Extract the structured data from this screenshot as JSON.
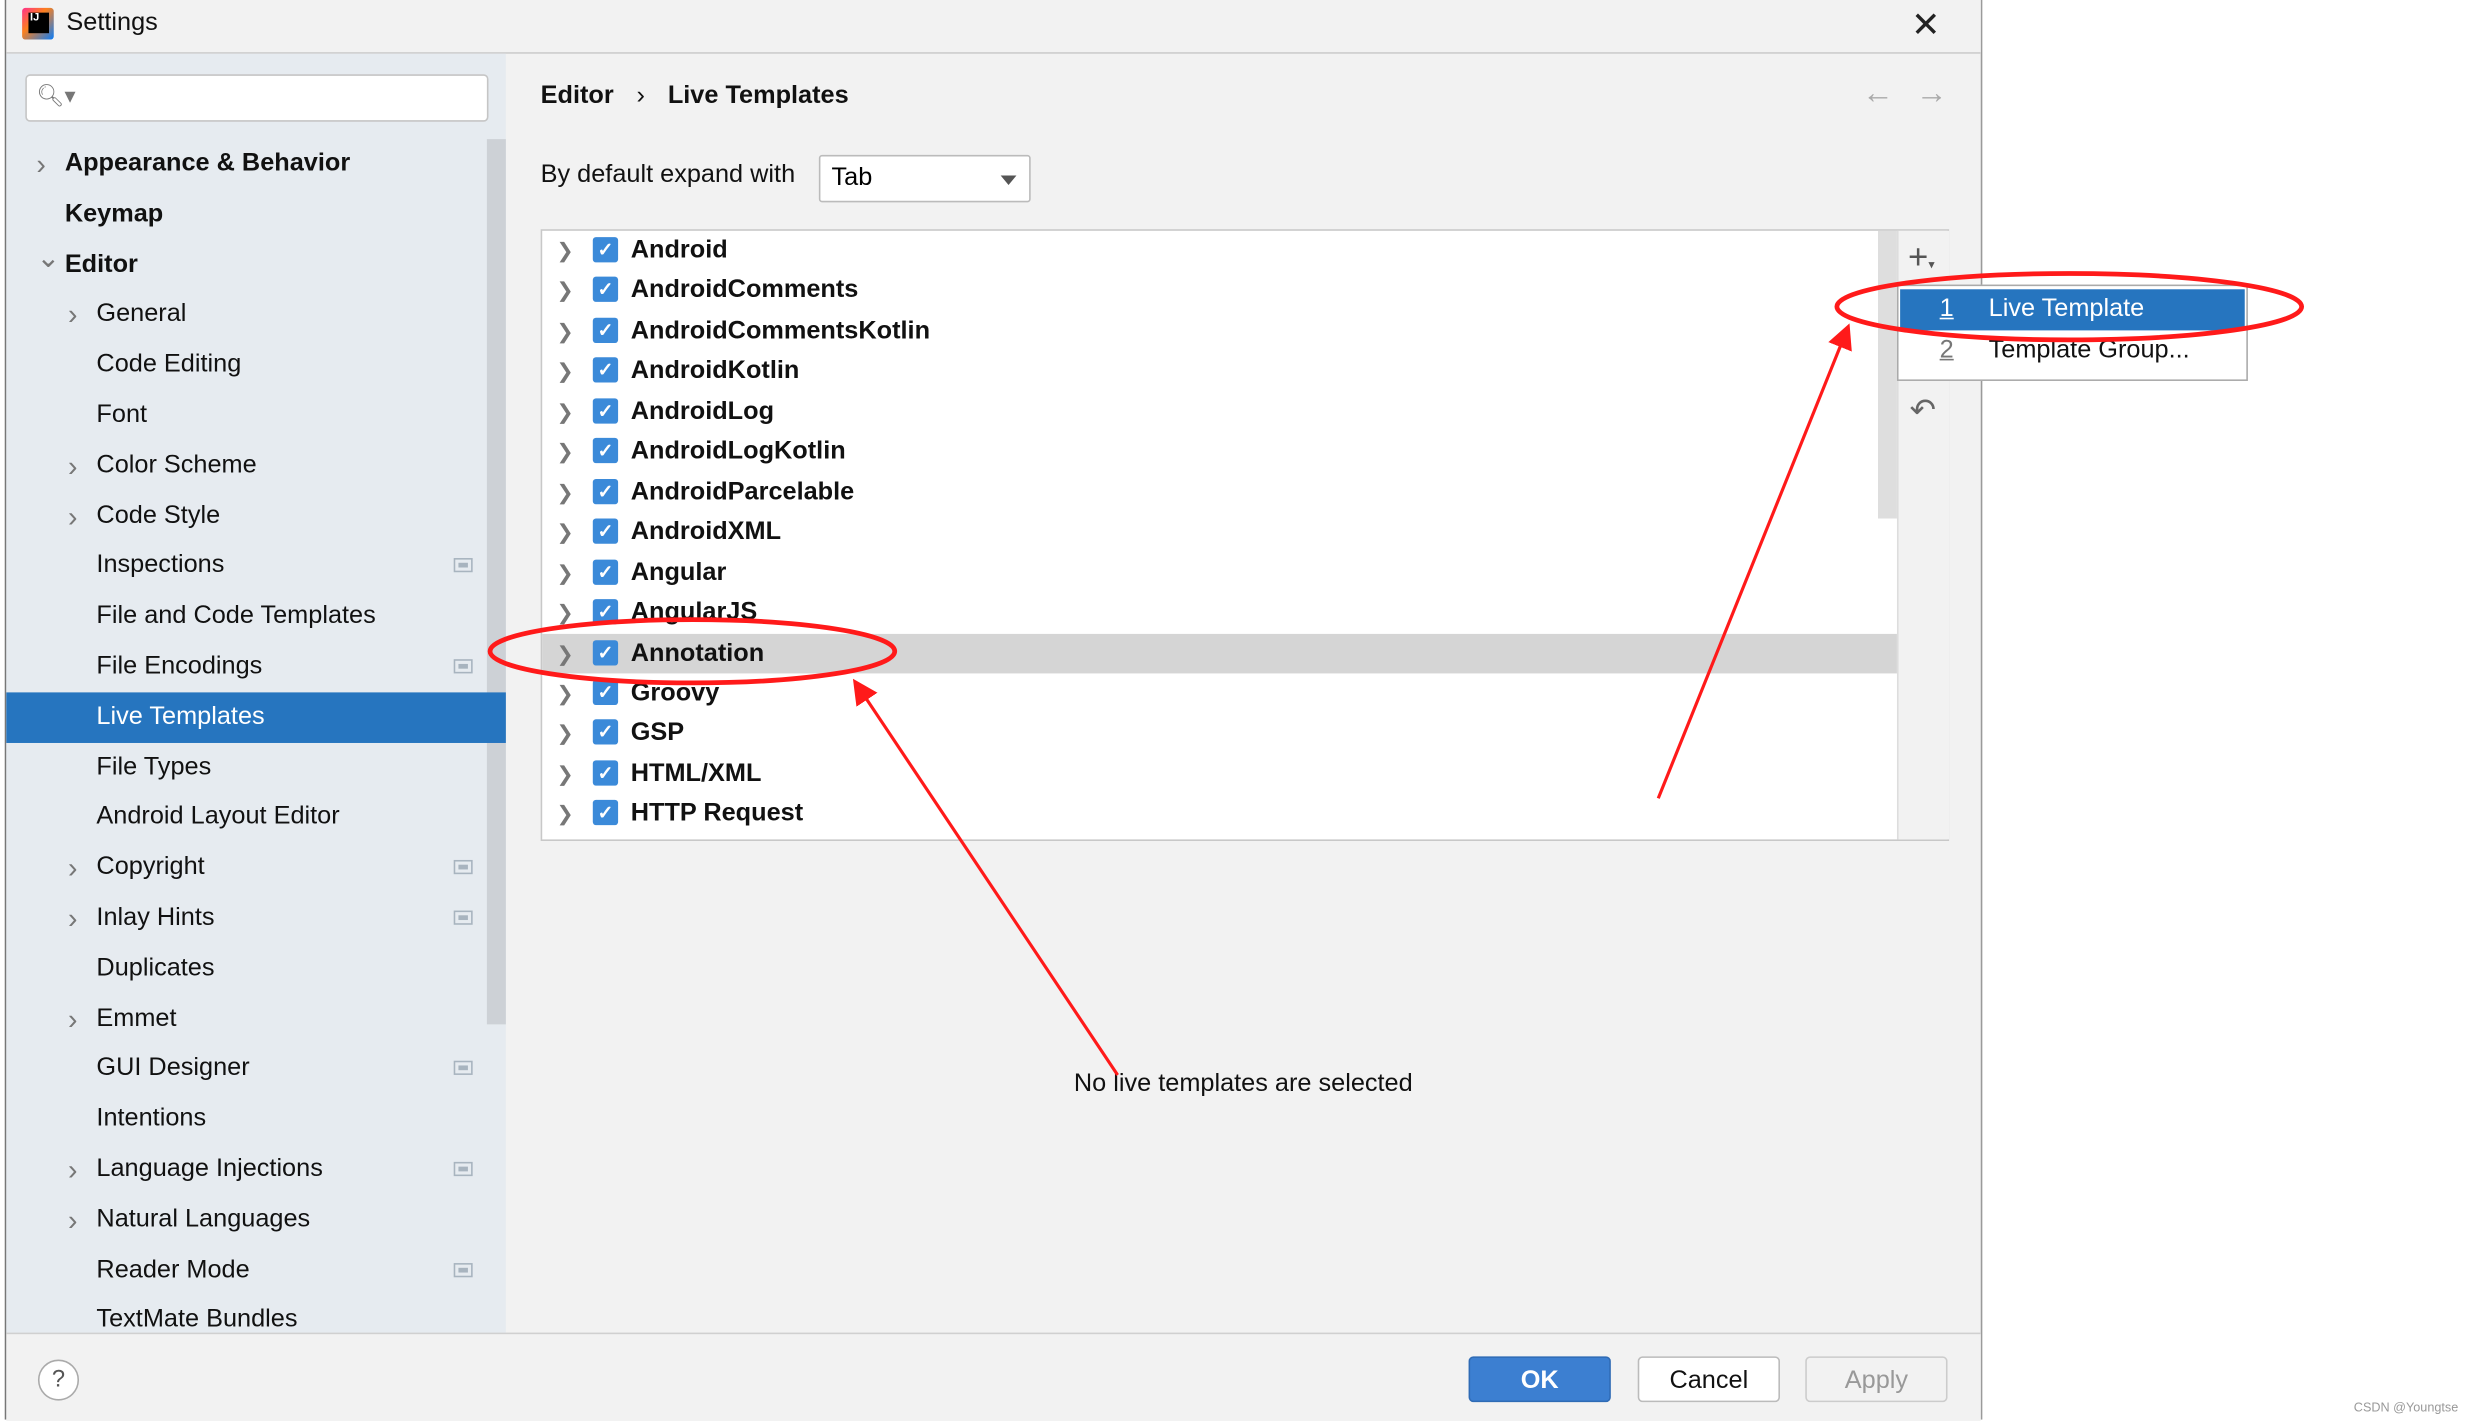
{
  "window": {
    "title": "Settings",
    "close_icon": "close-icon"
  },
  "sidebar": {
    "search_placeholder": "",
    "items": [
      {
        "label": "Appearance & Behavior",
        "level": 0,
        "bold": true,
        "chevron": "right"
      },
      {
        "label": "Keymap",
        "level": 0,
        "bold": true
      },
      {
        "label": "Editor",
        "level": 0,
        "bold": true,
        "chevron": "down"
      },
      {
        "label": "General",
        "level": 1,
        "chevron": "right"
      },
      {
        "label": "Code Editing",
        "level": 1
      },
      {
        "label": "Font",
        "level": 1
      },
      {
        "label": "Color Scheme",
        "level": 1,
        "chevron": "right"
      },
      {
        "label": "Code Style",
        "level": 1,
        "chevron": "right"
      },
      {
        "label": "Inspections",
        "level": 1,
        "project_icon": true
      },
      {
        "label": "File and Code Templates",
        "level": 1
      },
      {
        "label": "File Encodings",
        "level": 1,
        "project_icon": true
      },
      {
        "label": "Live Templates",
        "level": 1,
        "selected": true
      },
      {
        "label": "File Types",
        "level": 1
      },
      {
        "label": "Android Layout Editor",
        "level": 1
      },
      {
        "label": "Copyright",
        "level": 1,
        "chevron": "right",
        "project_icon": true
      },
      {
        "label": "Inlay Hints",
        "level": 1,
        "chevron": "right",
        "project_icon": true
      },
      {
        "label": "Duplicates",
        "level": 1
      },
      {
        "label": "Emmet",
        "level": 1,
        "chevron": "right"
      },
      {
        "label": "GUI Designer",
        "level": 1,
        "project_icon": true
      },
      {
        "label": "Intentions",
        "level": 1
      },
      {
        "label": "Language Injections",
        "level": 1,
        "chevron": "right",
        "project_icon": true
      },
      {
        "label": "Natural Languages",
        "level": 1,
        "chevron": "right"
      },
      {
        "label": "Reader Mode",
        "level": 1,
        "project_icon": true
      },
      {
        "label": "TextMate Bundles",
        "level": 1
      }
    ]
  },
  "breadcrumb": {
    "parent": "Editor",
    "separator": "›",
    "current": "Live Templates"
  },
  "expand": {
    "label": "By default expand with",
    "value": "Tab"
  },
  "templates": [
    {
      "label": "Android",
      "checked": true
    },
    {
      "label": "AndroidComments",
      "checked": true
    },
    {
      "label": "AndroidCommentsKotlin",
      "checked": true
    },
    {
      "label": "AndroidKotlin",
      "checked": true
    },
    {
      "label": "AndroidLog",
      "checked": true
    },
    {
      "label": "AndroidLogKotlin",
      "checked": true
    },
    {
      "label": "AndroidParcelable",
      "checked": true
    },
    {
      "label": "AndroidXML",
      "checked": true
    },
    {
      "label": "Angular",
      "checked": true
    },
    {
      "label": "AngularJS",
      "checked": true
    },
    {
      "label": "Annotation",
      "checked": true,
      "highlighted": true
    },
    {
      "label": "Groovy",
      "checked": true
    },
    {
      "label": "GSP",
      "checked": true
    },
    {
      "label": "HTML/XML",
      "checked": true
    },
    {
      "label": "HTTP Request",
      "checked": true
    }
  ],
  "add_menu": [
    {
      "number": "1",
      "label": "Live Template",
      "selected": true
    },
    {
      "number": "2",
      "label": "Template Group..."
    }
  ],
  "empty_message": "No live templates are selected",
  "buttons": {
    "ok": "OK",
    "cancel": "Cancel",
    "apply": "Apply",
    "help": "?"
  },
  "watermark": "CSDN @Youngtse",
  "colors": {
    "selection": "#2675bf",
    "annotation": "#ff1a1a",
    "checkbox": "#3b8ad9"
  }
}
